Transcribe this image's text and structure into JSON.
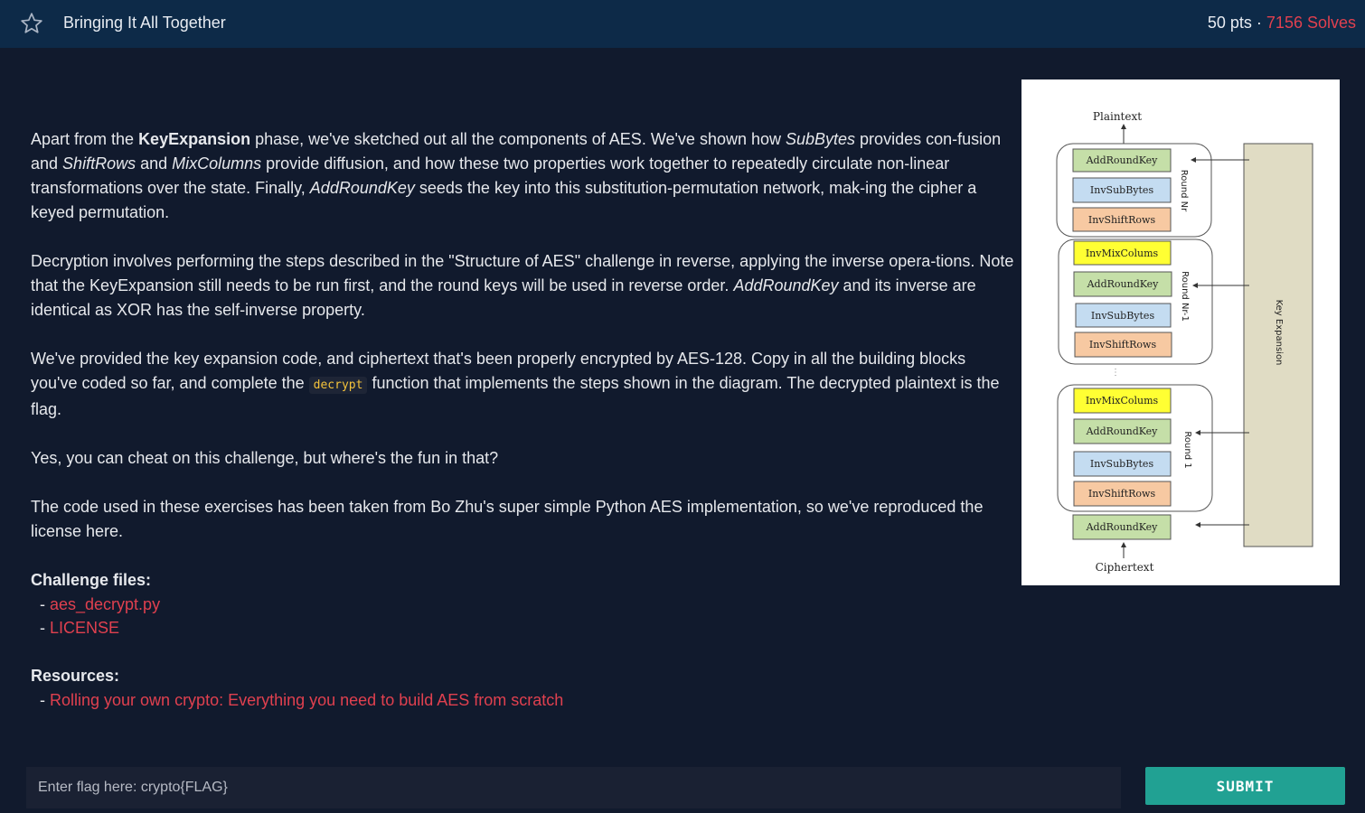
{
  "header": {
    "title": "Bringing It All Together",
    "points": "50 pts",
    "separator": " · ",
    "solves": "7156 Solves"
  },
  "body": {
    "p1": {
      "a": "Apart from the ",
      "b": "KeyExpansion",
      "c": " phase, we've sketched out all the components of AES. We've shown how ",
      "d": "SubBytes",
      "e": " provides con-fusion and ",
      "f": "ShiftRows",
      "g": " and ",
      "h": "MixColumns",
      "i": " provide diffusion, and how these two properties work together to repeatedly circulate non-linear transformations over the state. Finally, ",
      "j": "AddRoundKey",
      "k": " seeds the key into this substitution-permutation network, mak-ing the cipher a keyed permutation."
    },
    "p2": {
      "a": "Decryption involves performing the steps described in the \"Structure of AES\" challenge in reverse, applying the inverse opera-tions. Note that the KeyExpansion still needs to be run first, and the round keys will be used in reverse order. ",
      "b": "AddRoundKey",
      "c": " and its inverse are identical as XOR has the self-inverse property."
    },
    "p3": {
      "a": "We've provided the key expansion code, and ciphertext that's been properly encrypted by AES-128. Copy in all the building blocks you've coded so far, and complete the ",
      "code": "decrypt",
      "b": " function that implements the steps shown in the diagram. The decrypted plaintext is the flag."
    },
    "p4": "Yes, you can cheat on this challenge, but where's the fun in that?",
    "p5": "The code used in these exercises has been taken from Bo Zhu's super simple Python AES implementation, so we've reproduced the license here.",
    "files_heading": "Challenge files:",
    "files": [
      "aes_decrypt.py",
      "LICENSE"
    ],
    "resources_heading": "Resources:",
    "resources": [
      "Rolling your own crypto: Everything you need to build AES from scratch"
    ],
    "dash": "- "
  },
  "diagram": {
    "plaintext": "Plaintext",
    "ciphertext": "Ciphertext",
    "key_expansion": "Key Expansion",
    "round_nr": "Round Nr",
    "round_nr1": "Round Nr-1",
    "round_1": "Round 1",
    "add_round_key": "AddRoundKey",
    "inv_sub_bytes": "InvSubBytes",
    "inv_shift_rows": "InvShiftRows",
    "inv_mix_columns": "InvMixColums",
    "ellipsis": "⋮"
  },
  "form": {
    "placeholder": "Enter flag here: crypto{FLAG}",
    "submit": "SUBMIT"
  },
  "colors": {
    "accent": "#e0404f",
    "header_bg": "#0d2a48",
    "page_bg": "#111a2d",
    "submit_bg": "#21a193",
    "green_box": "#c5dfa8",
    "blue_box": "#c4dcf1",
    "orange_box": "#f7c9a2",
    "yellow_box": "#ffff33",
    "key_exp_box": "#e0dcc4"
  },
  "icons": {
    "favorite": "star-outline-icon"
  }
}
